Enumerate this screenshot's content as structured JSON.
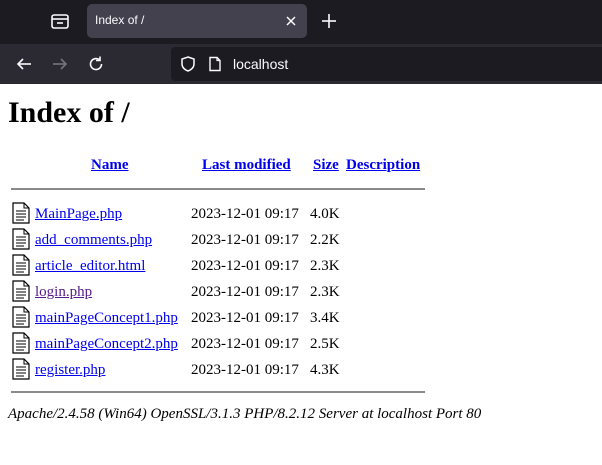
{
  "browser": {
    "tab_title": "Index of /",
    "url": "localhost"
  },
  "page": {
    "heading": "Index of /",
    "columns": {
      "name": "Name",
      "last_modified": "Last modified",
      "size": "Size",
      "description": "Description"
    },
    "files": [
      {
        "name": "MainPage.php",
        "modified": "2023-12-01 09:17",
        "size": "4.0K",
        "visited": false
      },
      {
        "name": "add_comments.php",
        "modified": "2023-12-01 09:17",
        "size": "2.2K",
        "visited": false
      },
      {
        "name": "article_editor.html",
        "modified": "2023-12-01 09:17",
        "size": "2.3K",
        "visited": false
      },
      {
        "name": "login.php",
        "modified": "2023-12-01 09:17",
        "size": "2.3K",
        "visited": true
      },
      {
        "name": "mainPageConcept1.php",
        "modified": "2023-12-01 09:17",
        "size": "3.4K",
        "visited": false
      },
      {
        "name": "mainPageConcept2.php",
        "modified": "2023-12-01 09:17",
        "size": "2.5K",
        "visited": false
      },
      {
        "name": "register.php",
        "modified": "2023-12-01 09:17",
        "size": "4.3K",
        "visited": false
      }
    ],
    "server_signature": "Apache/2.4.58 (Win64) OpenSSL/3.1.3 PHP/8.2.12 Server at localhost Port 80"
  },
  "colors": {
    "link": "#0000ee",
    "visited_link": "#551a8b"
  }
}
